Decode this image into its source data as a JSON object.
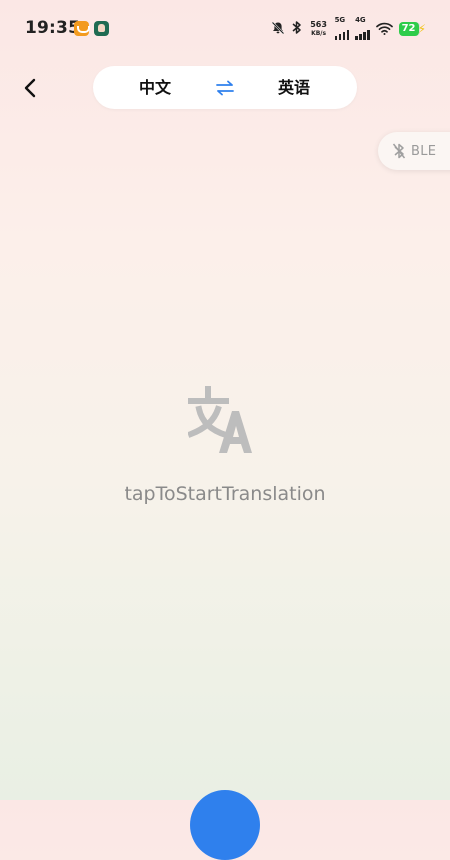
{
  "status_bar": {
    "time": "19:35",
    "net_speed_value": "563",
    "net_speed_unit": "KB/s",
    "signal1_label": "5G",
    "signal2_label": "4G",
    "battery_level": "72",
    "icons": [
      "notification-app-icon",
      "game-app-icon",
      "mute-bell-icon",
      "bluetooth-icon",
      "wifi-icon",
      "charging-icon"
    ]
  },
  "header": {
    "source_language": "中文",
    "target_language": "英语",
    "swap_icon": "swap-arrows-icon",
    "back_icon": "chevron-left-icon"
  },
  "ble": {
    "label": "BLE",
    "icon": "bluetooth-off-icon"
  },
  "main": {
    "prompt": "tapToStartTranslation",
    "icon": "translate-icon"
  },
  "colors": {
    "accent": "#2f80ed",
    "battery": "#2ecc4a",
    "muted_text": "#8a8a8a",
    "icon_gray": "#bdbdbd"
  }
}
